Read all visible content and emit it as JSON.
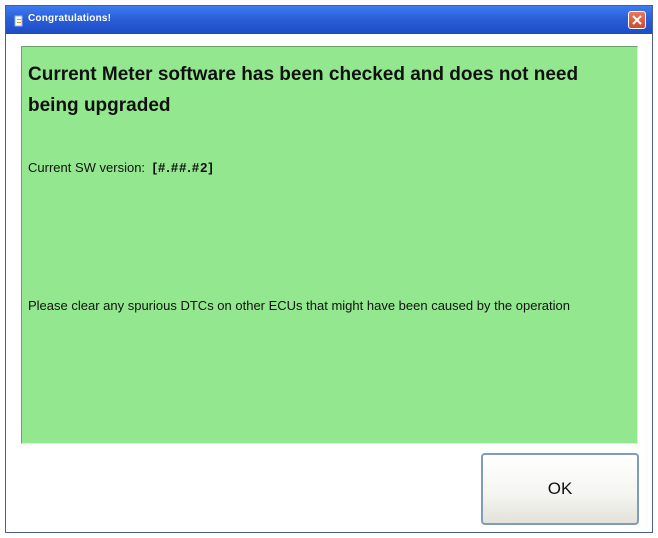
{
  "window": {
    "title": "Congratulations!",
    "icon": "app-icon",
    "close_icon": "close-icon",
    "accent_color": "#2a5fd8"
  },
  "message": {
    "background_color": "#93e88f",
    "headline": "Current Meter software has been checked and does not need being upgraded",
    "version_label": "Current SW version:",
    "version_value": "[#.##.#2]",
    "instruction": "Please clear any spurious DTCs on other ECUs that might have been caused by the operation"
  },
  "buttons": {
    "ok_label": "OK"
  }
}
